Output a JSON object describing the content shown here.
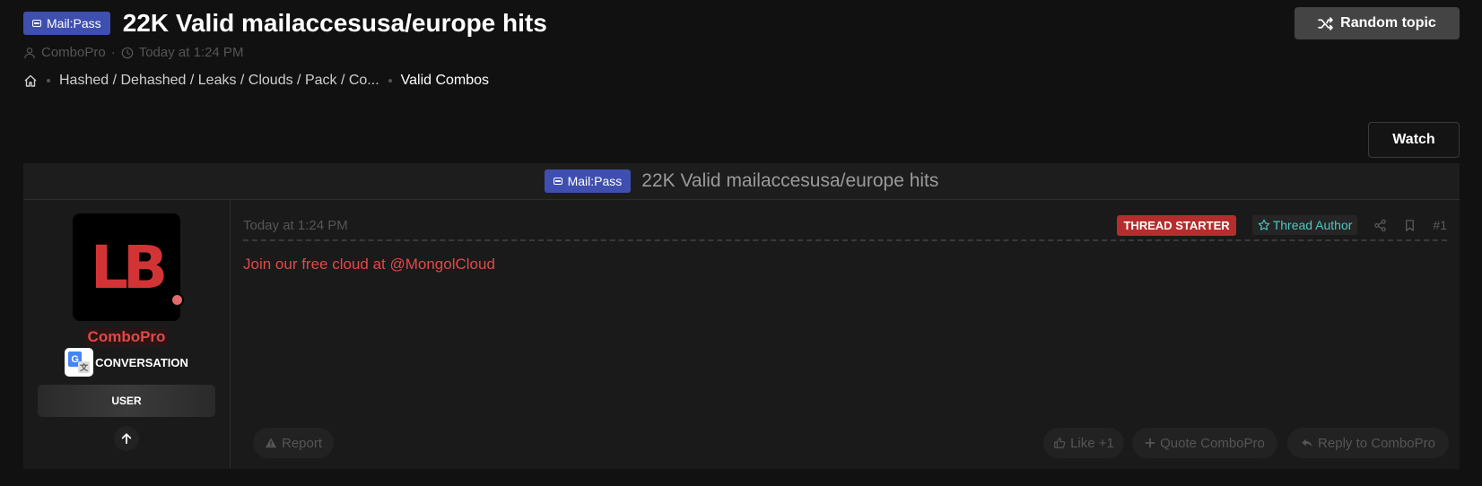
{
  "header": {
    "prefix": "Mail:Pass",
    "title": "22K Valid mailaccesusa/europe hits",
    "author": "ComboPro",
    "separator": "·",
    "date": "Today at 1:24 PM",
    "random_topic_label": "Random topic"
  },
  "breadcrumbs": {
    "home_icon": "home-icon",
    "items": [
      "Hashed / Dehashed / Leaks / Clouds / Pack / Co...",
      "Valid Combos"
    ]
  },
  "watch_label": "Watch",
  "block": {
    "prefix": "Mail:Pass",
    "title": "22K Valid mailaccesusa/europe hits"
  },
  "user": {
    "avatar_text": "LB",
    "name": "ComboPro",
    "banner_text": "CONVERSATION",
    "title": "USER"
  },
  "post": {
    "date": "Today at 1:24 PM",
    "starter_badge": "THREAD STARTER",
    "author_badge": "Thread Author",
    "number": "#1",
    "body": "Join our free cloud at @MongolCloud",
    "actions": {
      "report": "Report",
      "like": "Like +1",
      "quote": "Quote ComboPro",
      "reply": "Reply to ComboPro"
    }
  },
  "colors": {
    "background": "#111111",
    "prefix": "#3f4fb0",
    "username": "#e24848",
    "starter_badge": "#b62d2d",
    "author_badge_text": "#4fc7c0"
  }
}
